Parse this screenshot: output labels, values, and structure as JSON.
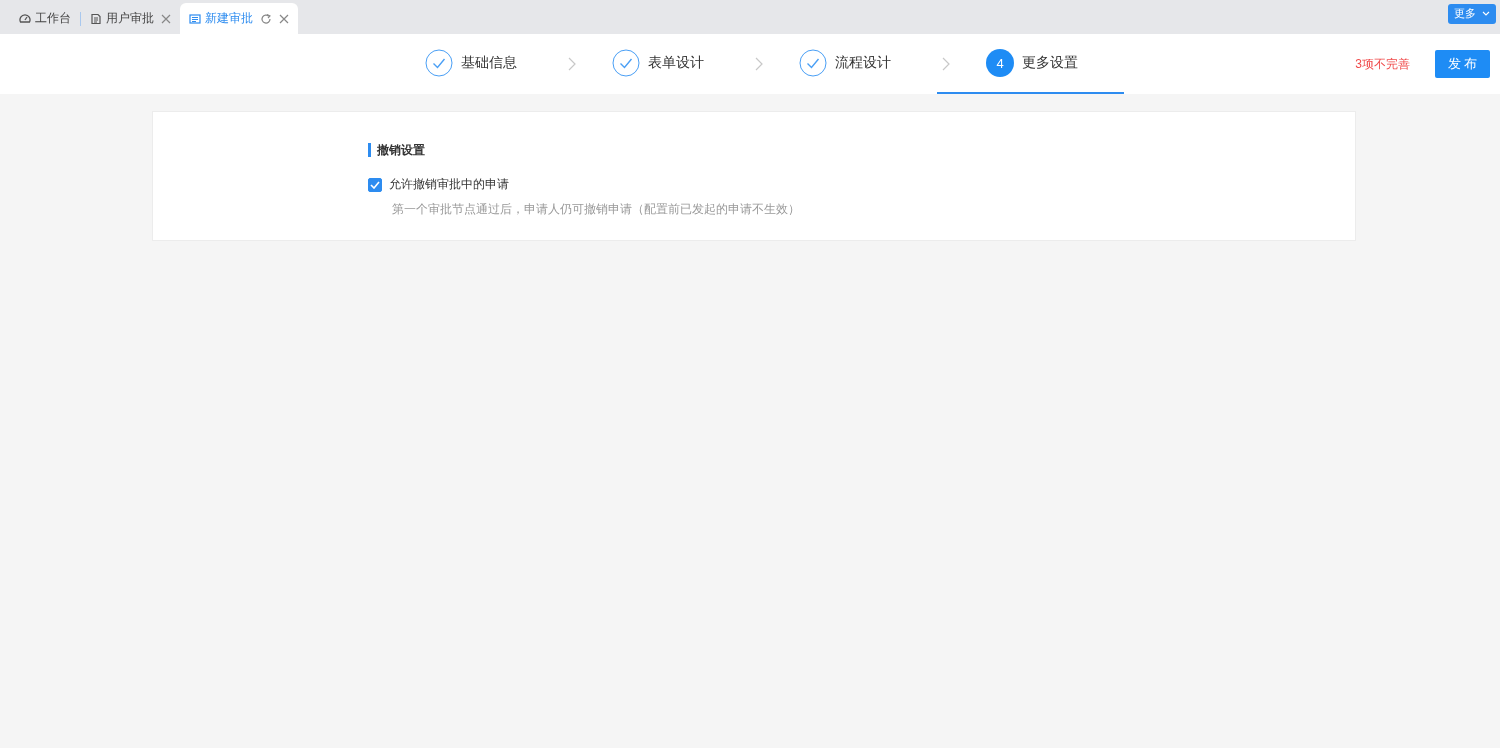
{
  "tabs": [
    {
      "label": "工作台",
      "kind": "fixed",
      "selected": false
    },
    {
      "label": "用户审批",
      "kind": "closable",
      "selected": false
    },
    {
      "label": "新建审批",
      "kind": "reloadable",
      "selected": true
    }
  ],
  "more_button": {
    "label": "更多"
  },
  "steps": [
    {
      "label": "基础信息",
      "kind": "done",
      "selected": false
    },
    {
      "label": "表单设计",
      "kind": "done",
      "selected": false
    },
    {
      "label": "流程设计",
      "kind": "done",
      "selected": false
    },
    {
      "label": "更多设置",
      "kind": "numbered",
      "number": "4",
      "selected": true
    }
  ],
  "warning": "3项不完善",
  "publish_button": "发 布",
  "section": {
    "title": "撤销设置",
    "settings": [
      {
        "label": "允许撤销审批中的申请",
        "checked": true,
        "hint": "第一个审批节点通过后，申请人仍可撤销申请（配置前已发起的申请不生效）"
      }
    ]
  }
}
